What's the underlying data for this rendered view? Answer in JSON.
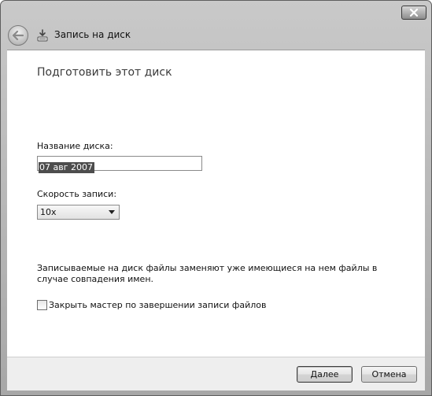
{
  "window": {
    "title": "Запись на диск"
  },
  "page": {
    "heading": "Подготовить этот диск"
  },
  "form": {
    "disc_name_label": "Название диска:",
    "disc_name_value": "07 авг 2007",
    "speed_label": "Скорость записи:",
    "speed_value": "10x"
  },
  "info_text": "Записываемые на диск файлы заменяют уже имеющиеся на нем файлы в случае совпадения имен.",
  "checkbox": {
    "label": "Закрыть мастер по завершении записи файлов",
    "checked": false
  },
  "buttons": {
    "next": "Далее",
    "cancel": "Отмена"
  },
  "icons": {
    "close": "close-icon",
    "back": "back-arrow-icon",
    "wizard": "disc-burn-icon"
  }
}
